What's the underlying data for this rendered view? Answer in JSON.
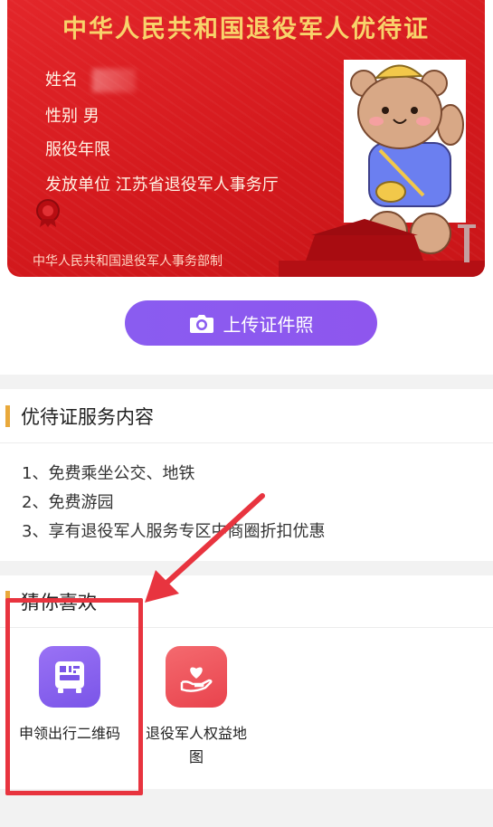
{
  "card": {
    "title": "中华人民共和国退役军人优待证",
    "name_label": "姓名",
    "gender_label": "性别",
    "gender_value": "男",
    "service_label": "服役年限",
    "issuer_label": "发放单位",
    "issuer_value": "江苏省退役军人事务厅",
    "ministry": "中华人民共和国退役军人事务部制"
  },
  "upload": {
    "label": "上传证件照"
  },
  "services": {
    "title": "优待证服务内容",
    "items": [
      "1、免费乘坐公交、地铁",
      "2、免费游园",
      "3、享有退役军人服务专区中商圈折扣优惠"
    ]
  },
  "guess": {
    "title": "猜你喜欢",
    "apps": [
      {
        "label": "申领出行二维码",
        "icon": "qr-bus-icon",
        "color": "#8a62ee"
      },
      {
        "label": "退役军人权益地图",
        "icon": "heart-hand-icon",
        "color": "#f0525a"
      }
    ]
  },
  "colors": {
    "card_red": "#d4191d",
    "title_gold": "#f8d36b",
    "accent_purple": "#8a5cf0",
    "section_bar": "#e9a93b",
    "annotation_red": "#e8343f"
  }
}
